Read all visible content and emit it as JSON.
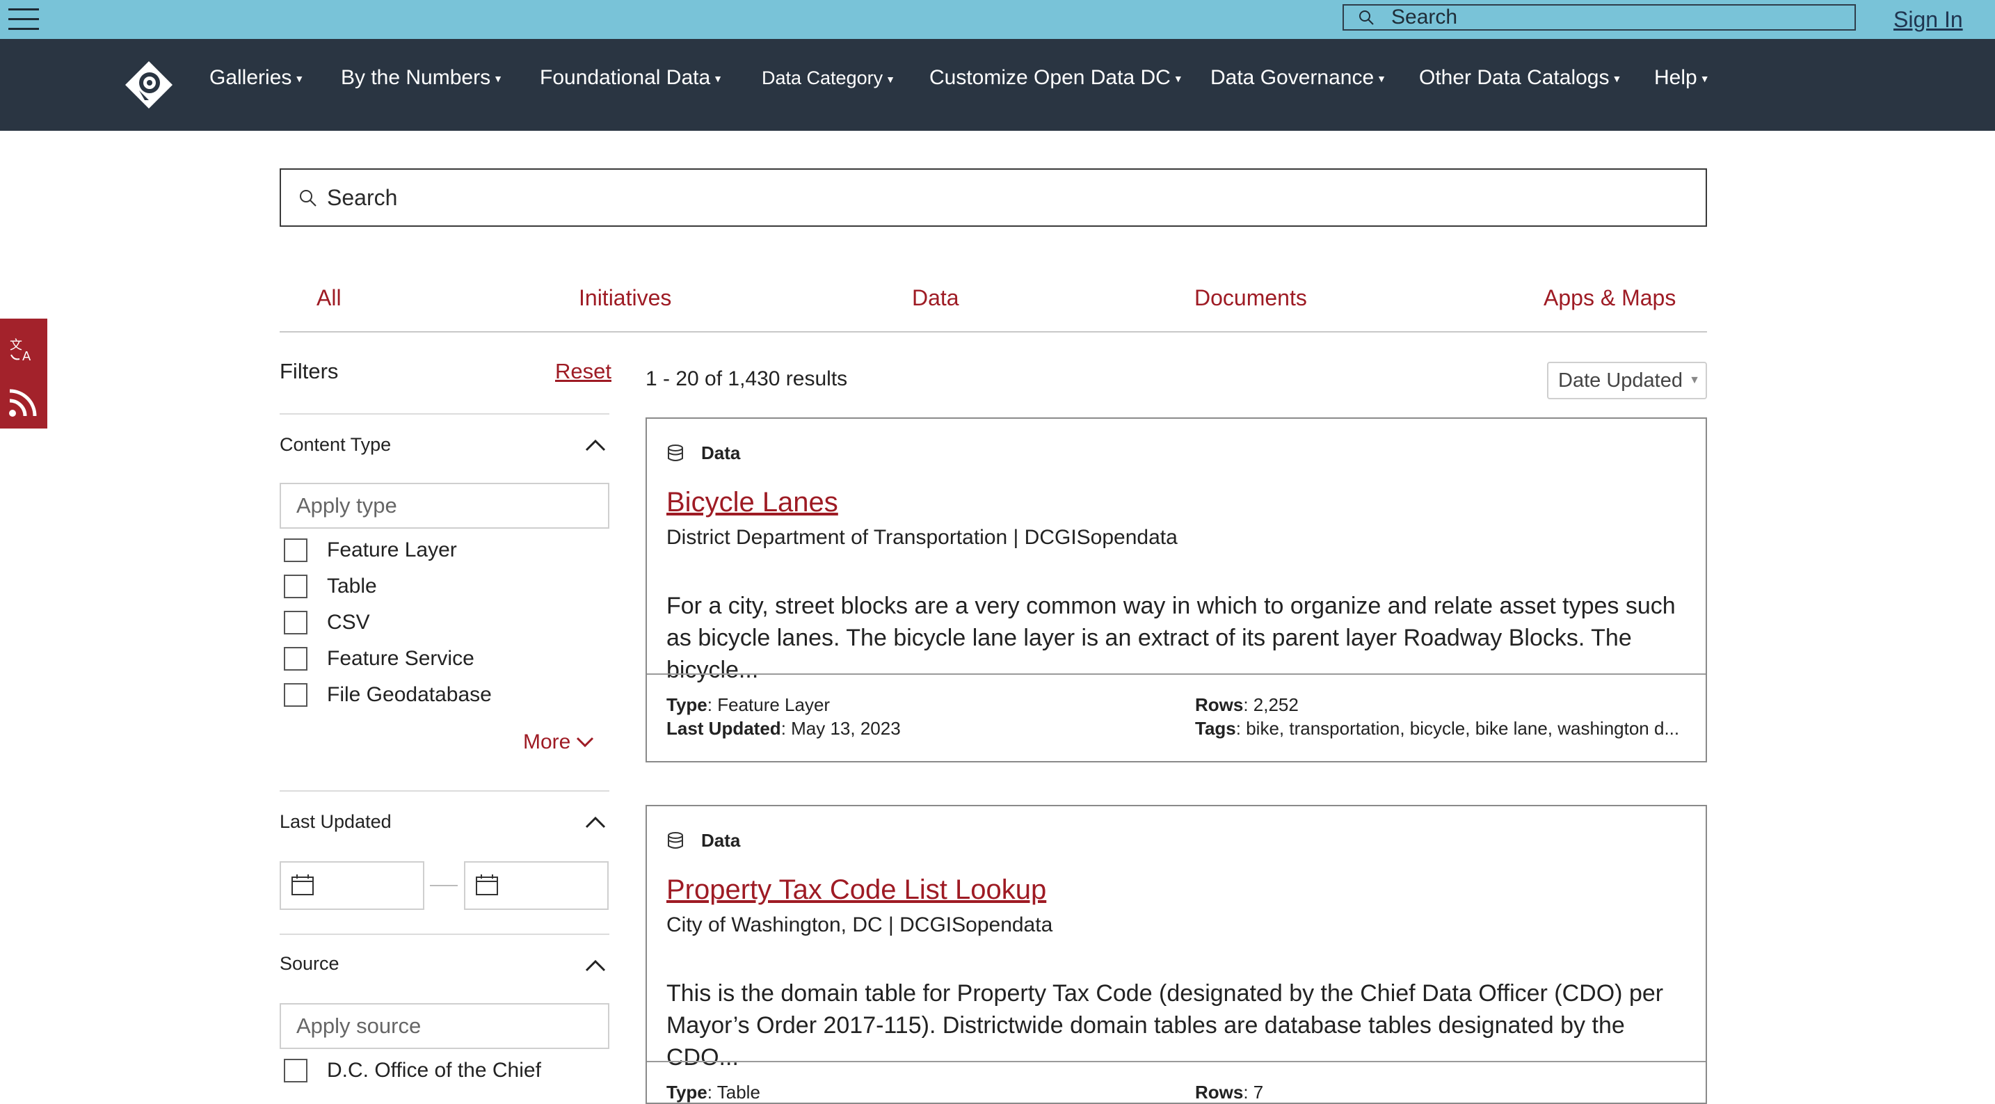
{
  "topbar": {
    "search_placeholder": "Search",
    "sign_in": "Sign In"
  },
  "nav": {
    "items": [
      {
        "label": "Galleries"
      },
      {
        "label": "By the Numbers"
      },
      {
        "label": "Foundational Data"
      },
      {
        "label": "Data Category"
      },
      {
        "label": "Customize Open Data DC"
      },
      {
        "label": "Data Governance"
      },
      {
        "label": "Other Data Catalogs"
      },
      {
        "label": "Help"
      }
    ],
    "caret": "▼"
  },
  "main_search": {
    "placeholder": "Search"
  },
  "tabs": [
    {
      "label": "All"
    },
    {
      "label": "Initiatives"
    },
    {
      "label": "Data"
    },
    {
      "label": "Documents"
    },
    {
      "label": "Apps & Maps"
    }
  ],
  "filters": {
    "title": "Filters",
    "reset": "Reset",
    "content_type": {
      "title": "Content Type",
      "placeholder": "Apply type",
      "options": [
        "Feature Layer",
        "Table",
        "CSV",
        "Feature Service",
        "File Geodatabase"
      ],
      "more": "More"
    },
    "last_updated": {
      "title": "Last Updated"
    },
    "source": {
      "title": "Source",
      "placeholder": "Apply source",
      "options": [
        "D.C. Office of the Chief"
      ]
    }
  },
  "results": {
    "count_text": "1 - 20 of 1,430 results",
    "sort_label": "Date Updated",
    "items": [
      {
        "kind": "Data",
        "title": "Bicycle Lanes",
        "owner": "District Department of Transportation | DCGISopendata",
        "description": "For a city, street blocks are a very common way in which to organize and relate asset types such as bicycle lanes. The bicycle lane layer is an extract of its parent layer Roadway Blocks. The bicycle...",
        "type_label": "Type",
        "type_value": ": Feature Layer",
        "updated_label": "Last Updated",
        "updated_value": ": May 13, 2023",
        "rows_label": "Rows",
        "rows_value": ": 2,252",
        "tags_label": "Tags",
        "tags_value": ": bike, transportation, bicycle, bike lane, washington d..."
      },
      {
        "kind": "Data",
        "title": "Property Tax Code List Lookup",
        "owner": "City of Washington, DC | DCGISopendata",
        "description": "This is the domain table for Property Tax Code (designated by the Chief Data Officer (CDO) per Mayor’s Order 2017-115). Districtwide domain tables are database tables designated by the CDO...",
        "type_label": "Type",
        "type_value": ": Table",
        "rows_label": "Rows",
        "rows_value": ": 7"
      }
    ]
  }
}
